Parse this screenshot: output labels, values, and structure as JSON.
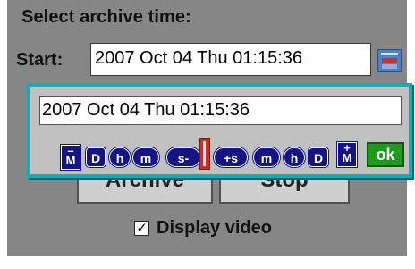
{
  "dialog": {
    "title": "Select archive time:",
    "start_label": "Start:",
    "start_value": "2007 Oct 04 Thu 01:15:36"
  },
  "popup": {
    "value": "2007 Oct 04 Thu 01:15:36",
    "back_buttons": [
      {
        "name": "minus-month",
        "top": "–",
        "label": "M"
      },
      {
        "name": "minus-day",
        "label": "D"
      },
      {
        "name": "minus-hour",
        "label": "h"
      },
      {
        "name": "minus-minute",
        "label": "m"
      },
      {
        "name": "minus-second",
        "label": "s-"
      }
    ],
    "forward_buttons": [
      {
        "name": "plus-second",
        "label": "+s"
      },
      {
        "name": "plus-minute",
        "label": "m"
      },
      {
        "name": "plus-hour",
        "label": "h"
      },
      {
        "name": "plus-day",
        "label": "D"
      },
      {
        "name": "plus-month",
        "top": "+",
        "label": "M"
      }
    ],
    "ok_label": "ok"
  },
  "background_buttons": {
    "archive": "Archive",
    "stop": "Stop"
  },
  "display_video": {
    "label": "Display video",
    "checked": true,
    "check_mark": "✓"
  },
  "icons": {
    "calendar": "calendar-icon",
    "slider": "time-slider-handle"
  }
}
